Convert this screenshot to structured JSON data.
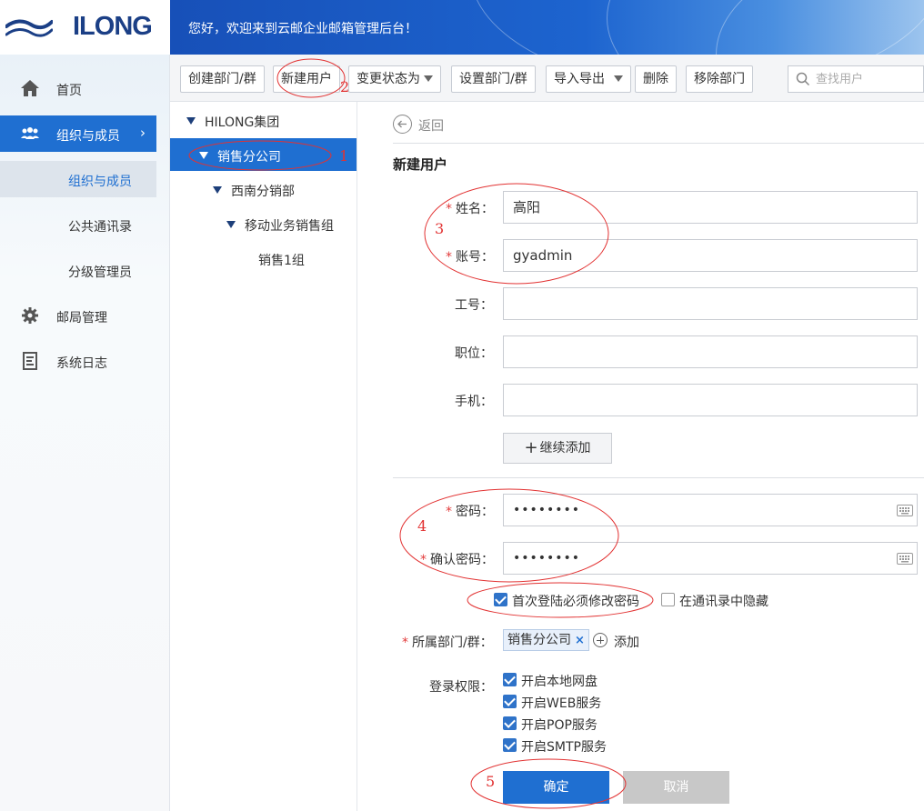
{
  "header": {
    "logo": "ILONG",
    "welcome": "您好，欢迎来到云邮企业邮箱管理后台！"
  },
  "sidebar": {
    "items": [
      {
        "label": "首页",
        "icon": "home-icon"
      },
      {
        "label": "组织与成员",
        "icon": "users-icon",
        "active": true
      },
      {
        "label": "邮局管理",
        "icon": "gear-icon"
      },
      {
        "label": "系统日志",
        "icon": "log-icon"
      }
    ],
    "sub_items": [
      {
        "label": "组织与成员",
        "active": true
      },
      {
        "label": "公共通讯录"
      },
      {
        "label": "分级管理员"
      }
    ]
  },
  "toolbar": {
    "create_dept": "创建部门/群",
    "new_user": "新建用户",
    "change_status": "变更状态为",
    "set_dept": "设置部门/群",
    "import_export": "导入导出",
    "delete": "删除",
    "remove_dept": "移除部门",
    "search_placeholder": "查找用户"
  },
  "tree": {
    "root": "HILONG集团",
    "selected": "销售分公司",
    "child1": "西南分销部",
    "child2": "移动业务销售组",
    "child3": "销售1组"
  },
  "form": {
    "back": "返回",
    "title": "新建用户",
    "name_label": "姓名：",
    "name_value": "高阳",
    "account_label": "账号：",
    "account_value": "gyadmin",
    "employee_id_label": "工号：",
    "position_label": "职位：",
    "phone_label": "手机：",
    "add_more": "继续添加",
    "password_label": "密码：",
    "password_value": "••••••••",
    "confirm_label": "确认密码：",
    "confirm_value": "••••••••",
    "must_change": "首次登陆必须修改密码",
    "must_change_checked": true,
    "hide_in_contacts": "在通讯录中隐藏",
    "hide_checked": false,
    "dept_label": "所属部门/群：",
    "dept_tag": "销售分公司",
    "add": "添加",
    "perm_label": "登录权限：",
    "permissions": [
      {
        "label": "开启本地网盘",
        "checked": true
      },
      {
        "label": "开启WEB服务",
        "checked": true
      },
      {
        "label": "开启POP服务",
        "checked": true
      },
      {
        "label": "开启SMTP服务",
        "checked": true
      }
    ],
    "confirm_button": "确定",
    "cancel_button": "取消"
  },
  "annotations": [
    "1",
    "2",
    "3",
    "4",
    "5"
  ],
  "colors": {
    "primary": "#1f6fd1",
    "annotation": "#e23232",
    "required": "#e23b3b",
    "brand": "#1b3f86"
  }
}
